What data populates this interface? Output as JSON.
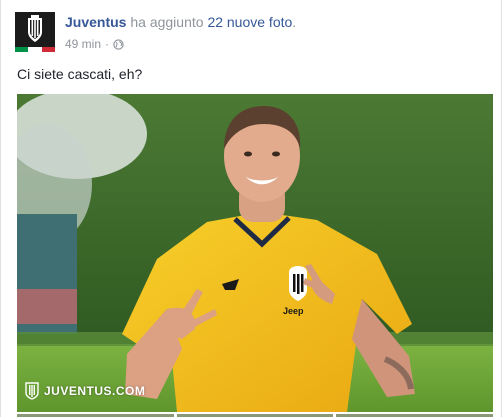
{
  "post": {
    "page_name": "Juventus",
    "action_text": " ha aggiunto ",
    "photos_link": "22 nuove foto",
    "action_end": ".",
    "timestamp": "49 min",
    "separator": "·",
    "privacy_icon": "globe-icon",
    "text": "Ci siete cascati, eh?"
  },
  "photo": {
    "watermark": "JUVENTUS.COM",
    "jersey_sponsor": "Jeep"
  },
  "colors": {
    "link": "#365899",
    "meta": "#90949c",
    "jersey": "#f5c518",
    "grass": "#6fa83a"
  }
}
